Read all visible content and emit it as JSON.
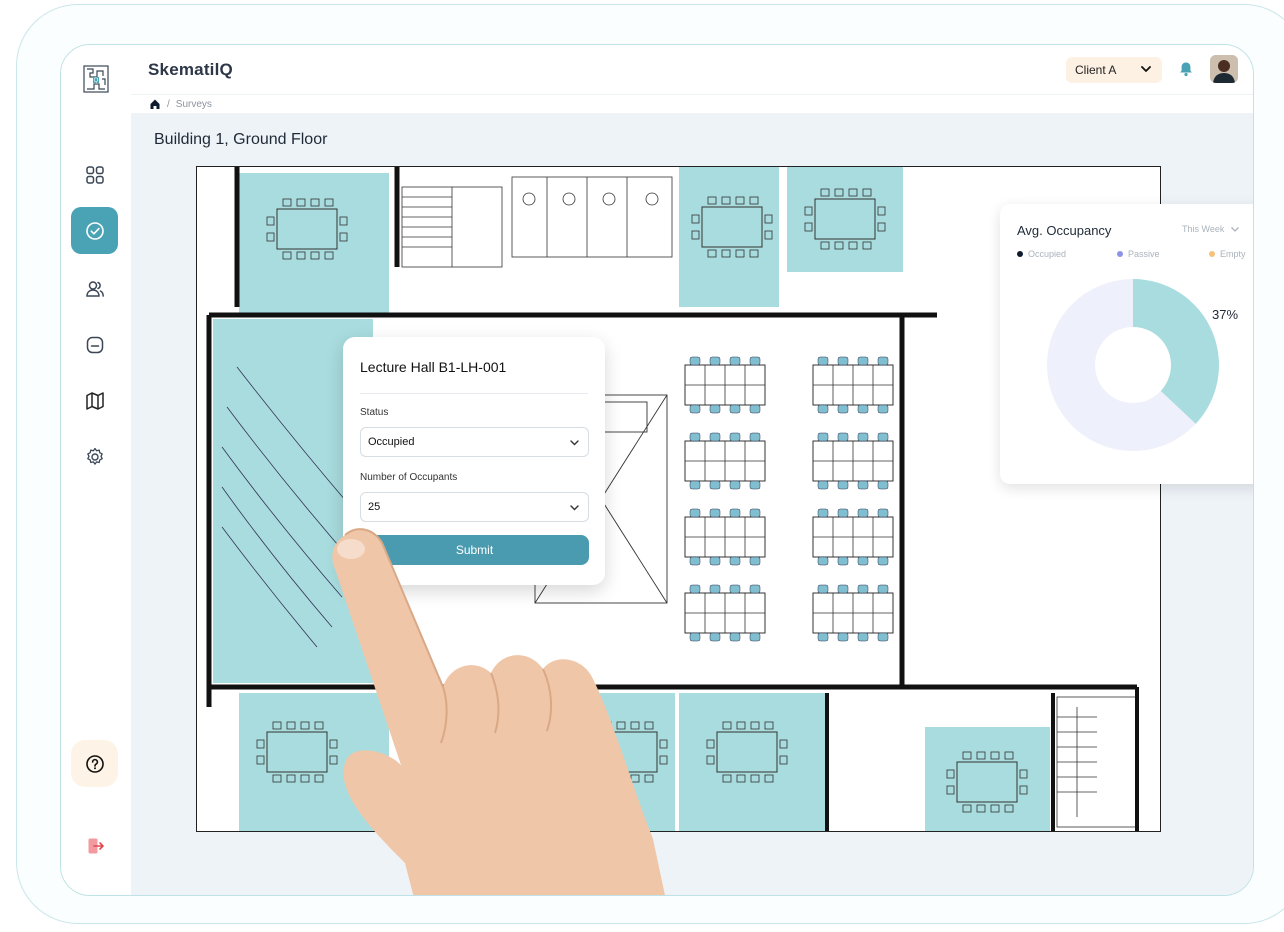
{
  "app": {
    "title": "SkematilQ"
  },
  "header": {
    "client_select": {
      "value": "Client A"
    },
    "icons": [
      "bell-icon",
      "user-avatar"
    ]
  },
  "breadcrumb": {
    "items": [
      "Surveys"
    ]
  },
  "page": {
    "title": "Building 1, Ground Floor"
  },
  "sidebar": {
    "items": [
      {
        "icon": "grid-icon"
      },
      {
        "icon": "check-circle-icon",
        "active": true
      },
      {
        "icon": "users-icon"
      },
      {
        "icon": "folder-icon"
      },
      {
        "icon": "map-icon"
      },
      {
        "icon": "gear-icon"
      }
    ],
    "help_icon": "question-icon",
    "logout_icon": "logout-icon"
  },
  "popup": {
    "title": "Lecture Hall B1-LH-001",
    "status": {
      "label": "Status",
      "value": "Occupied"
    },
    "occupants": {
      "label": "Number of Occupants",
      "value": "25"
    },
    "submit_label": "Submit"
  },
  "occupancy": {
    "title": "Avg. Occupancy",
    "period": "This Week",
    "legend": [
      {
        "name": "Occupied",
        "color": "#0f1b2e"
      },
      {
        "name": "Passive",
        "color": "#8d93e6"
      },
      {
        "name": "Empty",
        "color": "#f4c27a"
      }
    ],
    "percent_label": "37%",
    "colors": {
      "filled": "#a8dcde",
      "remaining": "#eef0fb"
    }
  },
  "chart_data": {
    "type": "pie",
    "title": "Avg. Occupancy",
    "categories": [
      "Occupied",
      "Remaining"
    ],
    "values": [
      37,
      63
    ],
    "labels": [
      "37%"
    ]
  },
  "colors": {
    "accent": "#4aa3b4",
    "room_fill": "#a8dcde",
    "chair": "#7fbfcf"
  }
}
